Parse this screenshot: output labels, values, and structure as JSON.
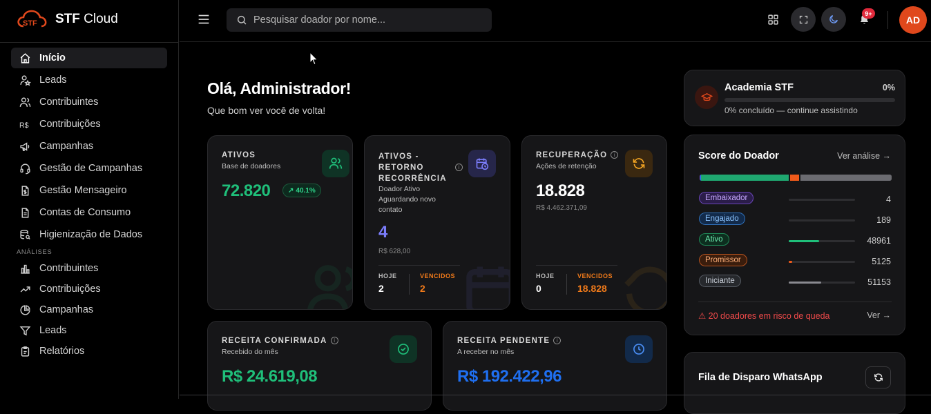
{
  "app": {
    "brand_bold": "STF",
    "brand_rest": " Cloud"
  },
  "sidebar": {
    "items": [
      {
        "label": "Início",
        "icon": "home-icon",
        "active": true
      },
      {
        "label": "Leads",
        "icon": "user-star-icon"
      },
      {
        "label": "Contribuintes",
        "icon": "users-icon"
      },
      {
        "label": "Contribuições",
        "icon": "currency-icon"
      },
      {
        "label": "Campanhas",
        "icon": "megaphone-icon"
      },
      {
        "label": "Gestão de Campanhas",
        "icon": "headset-icon"
      },
      {
        "label": "Gestão Mensageiro",
        "icon": "file-dollar-icon"
      },
      {
        "label": "Contas de Consumo",
        "icon": "file-text-icon"
      },
      {
        "label": "Higienização de Dados",
        "icon": "database-search-icon"
      }
    ],
    "section_label": "ANÁLISES",
    "analytics": [
      {
        "label": "Contribuintes",
        "icon": "bar-chart-icon"
      },
      {
        "label": "Contribuições",
        "icon": "trend-up-icon"
      },
      {
        "label": "Campanhas",
        "icon": "pie-chart-icon"
      },
      {
        "label": "Leads",
        "icon": "filter-icon"
      },
      {
        "label": "Relatórios",
        "icon": "clipboard-icon"
      }
    ]
  },
  "topbar": {
    "search_placeholder": "Pesquisar doador por nome...",
    "notif_badge": "9+",
    "avatar_initials": "AD"
  },
  "greeting": {
    "title": "Olá, Administrador!",
    "subtitle": "Que bom ver você de volta!"
  },
  "cards": {
    "ativos": {
      "title": "ATIVOS",
      "subtitle": "Base de doadores",
      "value": "72.820",
      "trend": "40.1%"
    },
    "recorrencia": {
      "title_l1": "ATIVOS -",
      "title_l2": "RETORNO",
      "title_l3": "RECORRÊNCIA",
      "subtitle_l1": "Doador Ativo",
      "subtitle_l2": "Aguardando novo",
      "subtitle_l3": "contato",
      "value": "4",
      "amount": "R$ 628,00",
      "today_label": "HOJE",
      "today_value": "2",
      "due_label": "VENCIDOS",
      "due_value": "2"
    },
    "recuperacao": {
      "title": "RECUPERAÇÃO",
      "subtitle": "Ações de retenção",
      "value": "18.828",
      "amount": "R$ 4.462.371,09",
      "today_label": "HOJE",
      "today_value": "0",
      "due_label": "VENCIDOS",
      "due_value": "18.828"
    },
    "receita_confirmada": {
      "title": "RECEITA CONFIRMADA",
      "subtitle": "Recebido do mês",
      "value": "R$ 24.619,08"
    },
    "receita_pendente": {
      "title": "RECEITA PENDENTE",
      "subtitle": "A receber no mês",
      "value": "R$ 192.422,96"
    }
  },
  "academia": {
    "title": "Academia STF",
    "percent": "0%",
    "progress": 0,
    "status": "0% concluído — continue assistindo"
  },
  "score": {
    "title": "Score do Doador",
    "link": "Ver análise →",
    "rows": [
      {
        "label": "Embaixador",
        "value": "4",
        "fraction": 0.0
      },
      {
        "label": "Engajado",
        "value": "189",
        "fraction": 0.0
      },
      {
        "label": "Ativo",
        "value": "48961",
        "fraction": 0.46
      },
      {
        "label": "Promissor",
        "value": "5125",
        "fraction": 0.05
      },
      {
        "label": "Iniciante",
        "value": "51153",
        "fraction": 0.49
      }
    ],
    "risk_text": "⚠ 20 doadores em risco de queda",
    "risk_link": "Ver →"
  },
  "whatsapp": {
    "title": "Fila de Disparo WhatsApp"
  },
  "colors": {
    "green": "#1fbf7a",
    "purple": "#7b7dfb",
    "orange": "#f07a1a",
    "blue": "#1f6ff0",
    "accent": "#e0481c"
  }
}
